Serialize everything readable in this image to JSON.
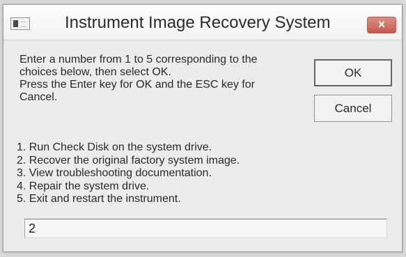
{
  "window": {
    "title": "Instrument Image Recovery System",
    "close_glyph": "×"
  },
  "message": {
    "lines": [
      "Enter a number from 1 to 5 corresponding to the",
      "choices below, then select OK.",
      "Press the Enter key for OK and the ESC key for",
      "Cancel."
    ]
  },
  "buttons": {
    "ok_label": "OK",
    "cancel_label": "Cancel"
  },
  "choices": [
    "1. Run Check Disk on the system drive.",
    "2. Recover the original factory system image.",
    "3. View troubleshooting documentation.",
    "4. Repair the system drive.",
    "5. Exit and restart the instrument."
  ],
  "input": {
    "value": "2"
  },
  "icons": {
    "app_icon": "window-app-icon",
    "close_icon": "close-icon"
  }
}
